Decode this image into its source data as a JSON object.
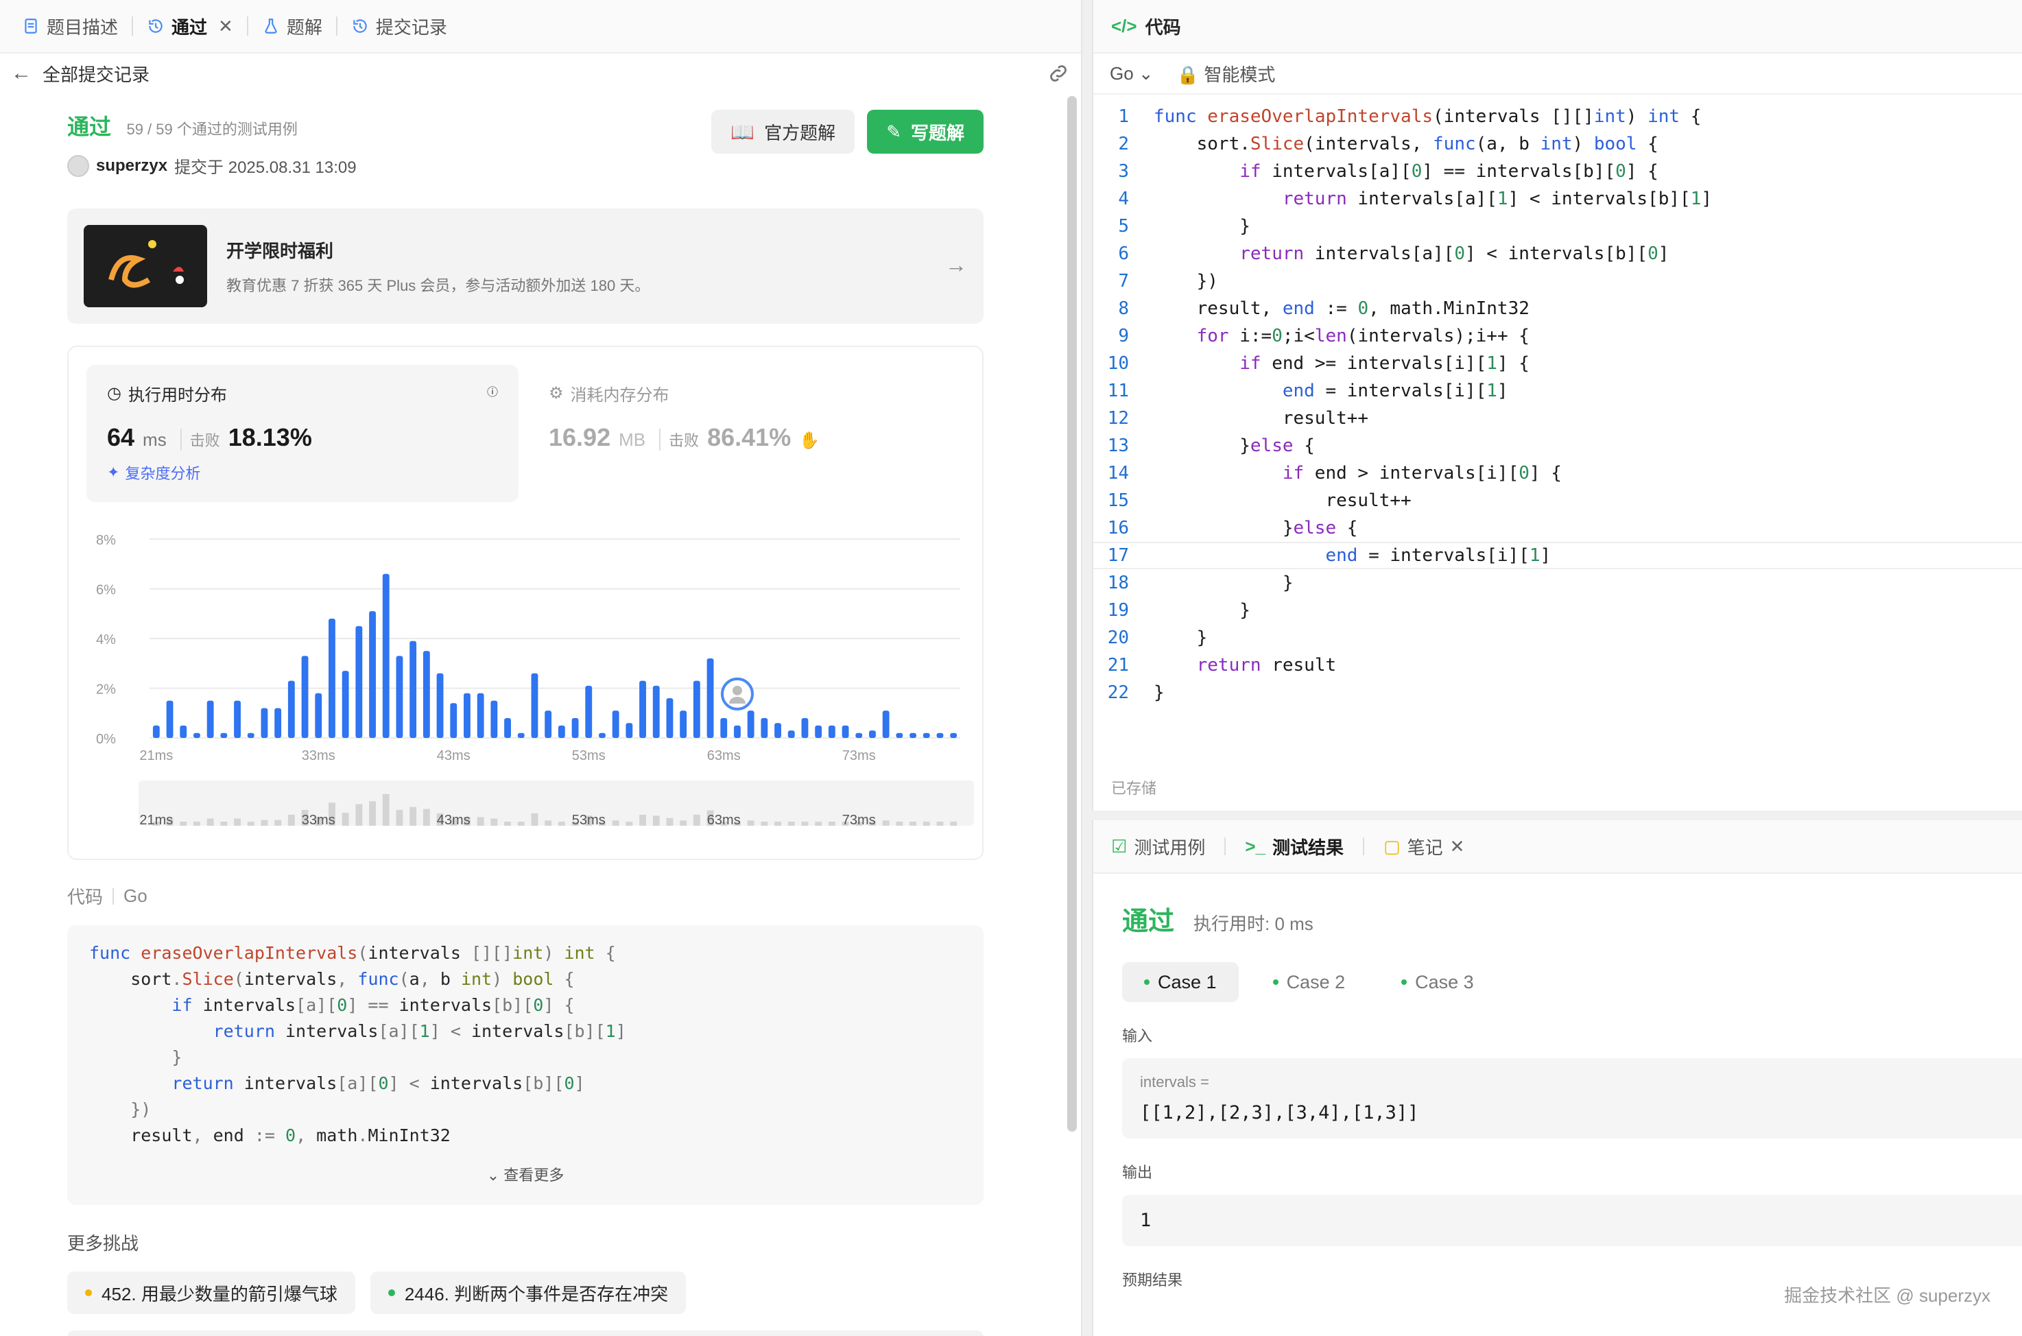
{
  "left": {
    "tabs": [
      {
        "label": "题目描述",
        "icon": "doc-icon"
      },
      {
        "label": "通过",
        "icon": "history-icon"
      },
      {
        "label": "题解",
        "icon": "flask-icon"
      },
      {
        "label": "提交记录",
        "icon": "history-icon"
      }
    ],
    "back_label": "全部提交记录",
    "status": {
      "title": "通过",
      "count": "59 / 59 个通过的测试用例",
      "user": "superzyx",
      "submitted": "提交于 2025.08.31 13:09"
    },
    "buttons": {
      "official": "官方题解",
      "write": "写题解"
    },
    "promo": {
      "title": "开学限时福利",
      "desc": "教育优惠 7 折获 365 天 Plus 会员，参与活动额外加送 180 天。"
    },
    "runtime": {
      "title": "执行用时分布",
      "value": "64",
      "unit": "ms",
      "beat_label": "击败",
      "beat": "18.13%",
      "analysis": "复杂度分析"
    },
    "memory": {
      "title": "消耗内存分布",
      "value": "16.92",
      "unit": "MB",
      "beat_label": "击败",
      "beat": "86.41%"
    },
    "code_label": {
      "title": "代码",
      "lang": "Go"
    },
    "more_label": "查看更多",
    "more_title": "更多挑战",
    "challenges": [
      {
        "label": "452. 用最少数量的箭引爆气球",
        "color": "#f5b400"
      },
      {
        "label": "2446. 判断两个事件是否存在冲突",
        "color": "#2db55d"
      }
    ]
  },
  "chart_data": {
    "type": "bar",
    "title": "执行用时分布",
    "ylim": [
      0,
      8
    ],
    "y_ticks": [
      "8%",
      "6%",
      "4%",
      "2%",
      "0%"
    ],
    "x_ticks": [
      "21ms",
      "33ms",
      "43ms",
      "53ms",
      "63ms",
      "73ms"
    ],
    "x": [
      21,
      22,
      23,
      24,
      25,
      26,
      27,
      28,
      29,
      30,
      31,
      32,
      33,
      34,
      35,
      36,
      37,
      38,
      39,
      40,
      41,
      42,
      43,
      44,
      45,
      46,
      47,
      48,
      49,
      50,
      51,
      52,
      53,
      54,
      55,
      56,
      57,
      58,
      59,
      60,
      61,
      62,
      63,
      64,
      65,
      66,
      67,
      68,
      69,
      70,
      71,
      72,
      73,
      74,
      75,
      76,
      77,
      78,
      79,
      80
    ],
    "values": [
      0.5,
      1.5,
      0.5,
      0.2,
      1.5,
      0.2,
      1.5,
      0.2,
      1.2,
      1.2,
      2.3,
      3.3,
      1.8,
      4.8,
      2.7,
      4.5,
      5.1,
      6.6,
      3.3,
      3.9,
      3.5,
      2.6,
      1.4,
      1.8,
      1.8,
      1.5,
      0.8,
      0.2,
      2.6,
      1.1,
      0.5,
      0.8,
      2.1,
      0.2,
      1.1,
      0.6,
      2.3,
      2.1,
      1.6,
      1.1,
      2.3,
      3.2,
      0.8,
      0.5,
      1.1,
      0.8,
      0.6,
      0.3,
      0.8,
      0.5,
      0.5,
      0.5,
      0.2,
      0.3,
      1.1,
      0.2,
      0.2,
      0.2,
      0.2,
      0.2
    ],
    "highlight_x": 64,
    "color": "#2f74f0"
  },
  "left_code": [
    [
      [
        "kw",
        "func "
      ],
      [
        "fn",
        "eraseOverlapIntervals"
      ],
      [
        "op",
        "("
      ],
      [
        "",
        "intervals "
      ],
      [
        "op",
        "[][]"
      ],
      [
        "ty2",
        "int"
      ],
      [
        "op",
        ") "
      ],
      [
        "ty2",
        "int"
      ],
      [
        "op",
        " {"
      ]
    ],
    [
      [
        "",
        "    sort"
      ],
      [
        "op",
        "."
      ],
      [
        "fn",
        "Slice"
      ],
      [
        "op",
        "("
      ],
      [
        "",
        "intervals"
      ],
      [
        "op",
        ", "
      ],
      [
        "kw",
        "func"
      ],
      [
        "op",
        "("
      ],
      [
        "",
        "a"
      ],
      [
        "op",
        ", "
      ],
      [
        "",
        "b "
      ],
      [
        "ty2",
        "int"
      ],
      [
        "op",
        ") "
      ],
      [
        "ty2",
        "bool"
      ],
      [
        "op",
        " {"
      ]
    ],
    [
      [
        "",
        "        "
      ],
      [
        "kw",
        "if"
      ],
      [
        "",
        " intervals"
      ],
      [
        "op",
        "[a]["
      ],
      [
        "num",
        "0"
      ],
      [
        "op",
        "] == "
      ],
      [
        "",
        "intervals"
      ],
      [
        "op",
        "[b]["
      ],
      [
        "num",
        "0"
      ],
      [
        "op",
        "] {"
      ]
    ],
    [
      [
        "",
        "            "
      ],
      [
        "kw",
        "return"
      ],
      [
        "",
        " intervals"
      ],
      [
        "op",
        "[a]["
      ],
      [
        "num",
        "1"
      ],
      [
        "op",
        "] < "
      ],
      [
        "",
        "intervals"
      ],
      [
        "op",
        "[b]["
      ],
      [
        "num",
        "1"
      ],
      [
        "op",
        "]"
      ]
    ],
    [
      [
        "op",
        "        }"
      ]
    ],
    [
      [
        "",
        "        "
      ],
      [
        "kw",
        "return"
      ],
      [
        "",
        " intervals"
      ],
      [
        "op",
        "[a]["
      ],
      [
        "num",
        "0"
      ],
      [
        "op",
        "] < "
      ],
      [
        "",
        "intervals"
      ],
      [
        "op",
        "[b]["
      ],
      [
        "num",
        "0"
      ],
      [
        "op",
        "]"
      ]
    ],
    [
      [
        "op",
        "    })"
      ]
    ],
    [
      [
        "",
        "    result"
      ],
      [
        "op",
        ", "
      ],
      [
        "",
        "end "
      ],
      [
        "op",
        ":= "
      ],
      [
        "num",
        "0"
      ],
      [
        "op",
        ", "
      ],
      [
        "",
        "math"
      ],
      [
        "op",
        "."
      ],
      [
        "",
        "MinInt32"
      ]
    ]
  ],
  "editor": {
    "title": "代码",
    "lang": "Go",
    "mode": "智能模式",
    "saved": "已存储",
    "current_line": 17,
    "lines": [
      [
        [
          "kw",
          "func "
        ],
        [
          "fn",
          "eraseOverlapIntervals"
        ],
        [
          "",
          "(intervals [][]"
        ],
        [
          "ty",
          "int"
        ],
        [
          "",
          ") "
        ],
        [
          "ty",
          "int"
        ],
        [
          "",
          " {"
        ]
      ],
      [
        [
          "",
          "    sort."
        ],
        [
          "fn",
          "Slice"
        ],
        [
          "",
          "(intervals, "
        ],
        [
          "kw",
          "func"
        ],
        [
          "",
          "(a, b "
        ],
        [
          "ty",
          "int"
        ],
        [
          "",
          ") "
        ],
        [
          "ty",
          "bool"
        ],
        [
          "",
          " {"
        ]
      ],
      [
        [
          "",
          "        "
        ],
        [
          "kw2",
          "if"
        ],
        [
          "",
          " intervals[a]["
        ],
        [
          "num",
          "0"
        ],
        [
          "",
          "] == intervals[b]["
        ],
        [
          "num",
          "0"
        ],
        [
          "",
          "] {"
        ]
      ],
      [
        [
          "",
          "            "
        ],
        [
          "kw2",
          "return"
        ],
        [
          "",
          " intervals[a]["
        ],
        [
          "num",
          "1"
        ],
        [
          "",
          "] < intervals[b]["
        ],
        [
          "num",
          "1"
        ],
        [
          "",
          "]"
        ]
      ],
      [
        [
          "",
          "        }"
        ]
      ],
      [
        [
          "",
          "        "
        ],
        [
          "kw2",
          "return"
        ],
        [
          "",
          " intervals[a]["
        ],
        [
          "num",
          "0"
        ],
        [
          "",
          "] < intervals[b]["
        ],
        [
          "num",
          "0"
        ],
        [
          "",
          "]"
        ]
      ],
      [
        [
          "",
          "    })"
        ]
      ],
      [
        [
          "",
          "    result, "
        ],
        [
          "kw",
          "end"
        ],
        [
          "",
          " := "
        ],
        [
          "num",
          "0"
        ],
        [
          "",
          ", math.MinInt32"
        ]
      ],
      [
        [
          "",
          "    "
        ],
        [
          "kw2",
          "for"
        ],
        [
          "",
          " i:="
        ],
        [
          "num",
          "0"
        ],
        [
          "",
          ";i<"
        ],
        [
          "kw2",
          "len"
        ],
        [
          "",
          "(intervals);i++ {"
        ]
      ],
      [
        [
          "",
          "        "
        ],
        [
          "kw2",
          "if"
        ],
        [
          "",
          " end >= intervals[i]["
        ],
        [
          "num",
          "1"
        ],
        [
          "",
          "] {"
        ]
      ],
      [
        [
          "",
          "            "
        ],
        [
          "kw",
          "end"
        ],
        [
          "",
          " = intervals[i]["
        ],
        [
          "num",
          "1"
        ],
        [
          "",
          "]"
        ]
      ],
      [
        [
          "",
          "            result++"
        ]
      ],
      [
        [
          "",
          "        }"
        ],
        [
          "kw2",
          "else"
        ],
        [
          "",
          " {"
        ]
      ],
      [
        [
          "",
          "            "
        ],
        [
          "kw2",
          "if"
        ],
        [
          "",
          " end > intervals[i]["
        ],
        [
          "num",
          "0"
        ],
        [
          "",
          "] {"
        ]
      ],
      [
        [
          "",
          "                result++"
        ]
      ],
      [
        [
          "",
          "            }"
        ],
        [
          "kw2",
          "else"
        ],
        [
          "",
          " {"
        ]
      ],
      [
        [
          "",
          "                "
        ],
        [
          "kw",
          "end"
        ],
        [
          "",
          " = intervals[i]["
        ],
        [
          "num",
          "1"
        ],
        [
          "",
          "]"
        ]
      ],
      [
        [
          "",
          "            }"
        ]
      ],
      [
        [
          "",
          "        }"
        ]
      ],
      [
        [
          "",
          "    }"
        ]
      ],
      [
        [
          "",
          "    "
        ],
        [
          "kw2",
          "return"
        ],
        [
          "",
          " result"
        ]
      ],
      [
        [
          "",
          "}"
        ]
      ]
    ]
  },
  "result": {
    "tabs": [
      {
        "label": "测试用例",
        "icon": "checkbox-icon"
      },
      {
        "label": "测试结果",
        "icon": "terminal-icon"
      },
      {
        "label": "笔记",
        "icon": "note-icon"
      }
    ],
    "status": "通过",
    "time": "执行用时: 0 ms",
    "cases": [
      "Case 1",
      "Case 2",
      "Case 3"
    ],
    "input_label": "输入",
    "input_var": "intervals =",
    "input_value": "[[1,2],[2,3],[3,4],[1,3]]",
    "output_label": "输出",
    "output_value": "1",
    "expected_label": "预期结果"
  },
  "watermark": "掘金技术社区 @ superzyx"
}
